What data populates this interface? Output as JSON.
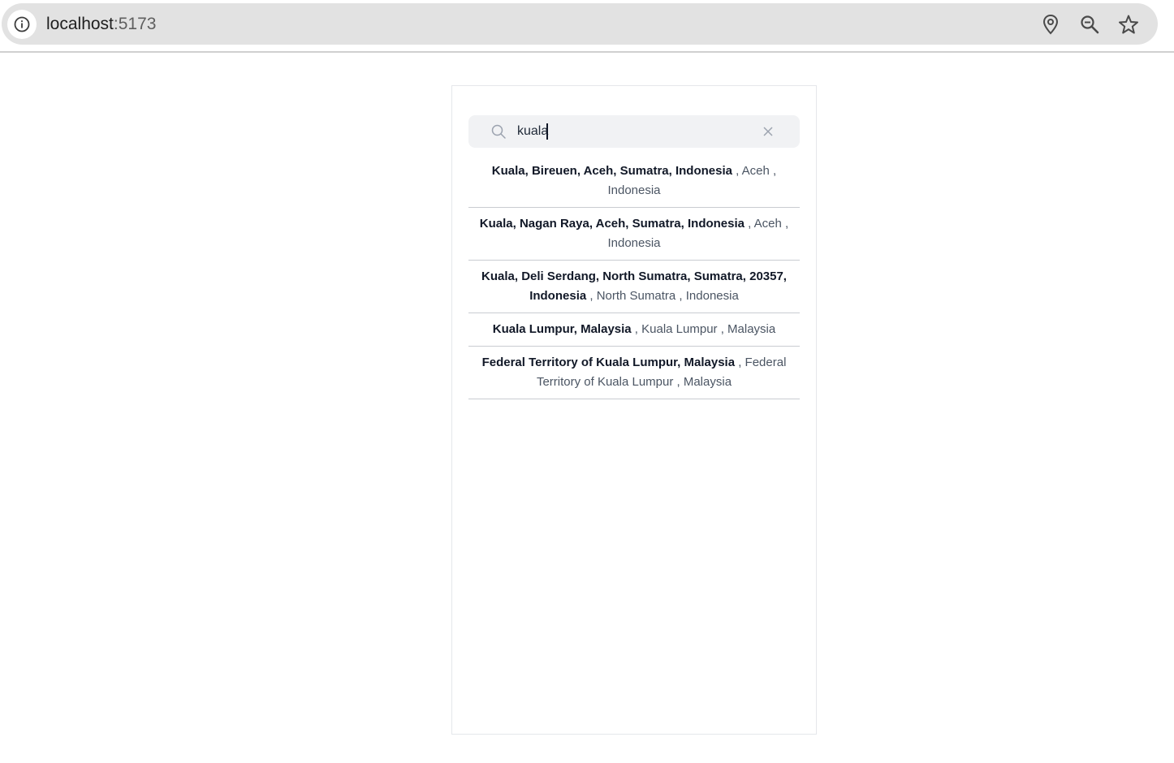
{
  "browser": {
    "url_host": "localhost",
    "url_port": ":5173",
    "icons": [
      "info-icon",
      "location-pin-icon",
      "zoom-icon",
      "bookmark-star-icon"
    ]
  },
  "search": {
    "value": "kuala",
    "placeholder": ""
  },
  "results": [
    {
      "name": "Kuala, Bireuen, Aceh, Sumatra, Indonesia",
      "detail": " , Aceh , Indonesia"
    },
    {
      "name": "Kuala, Nagan Raya, Aceh, Sumatra, Indonesia",
      "detail": " , Aceh , Indonesia"
    },
    {
      "name": "Kuala, Deli Serdang, North Sumatra, Sumatra, 20357, Indonesia",
      "detail": " , North Sumatra , Indonesia"
    },
    {
      "name": "Kuala Lumpur, Malaysia",
      "detail": " , Kuala Lumpur , Malaysia"
    },
    {
      "name": "Federal Territory of Kuala Lumpur, Malaysia",
      "detail": " , Federal Territory of Kuala Lumpur , Malaysia"
    }
  ],
  "colors": {
    "omnibox_bg": "#e2e2e2",
    "search_bg": "#f1f2f4",
    "name_text": "#111827",
    "detail_text": "#4b5563",
    "divider": "#c9ccd1"
  }
}
